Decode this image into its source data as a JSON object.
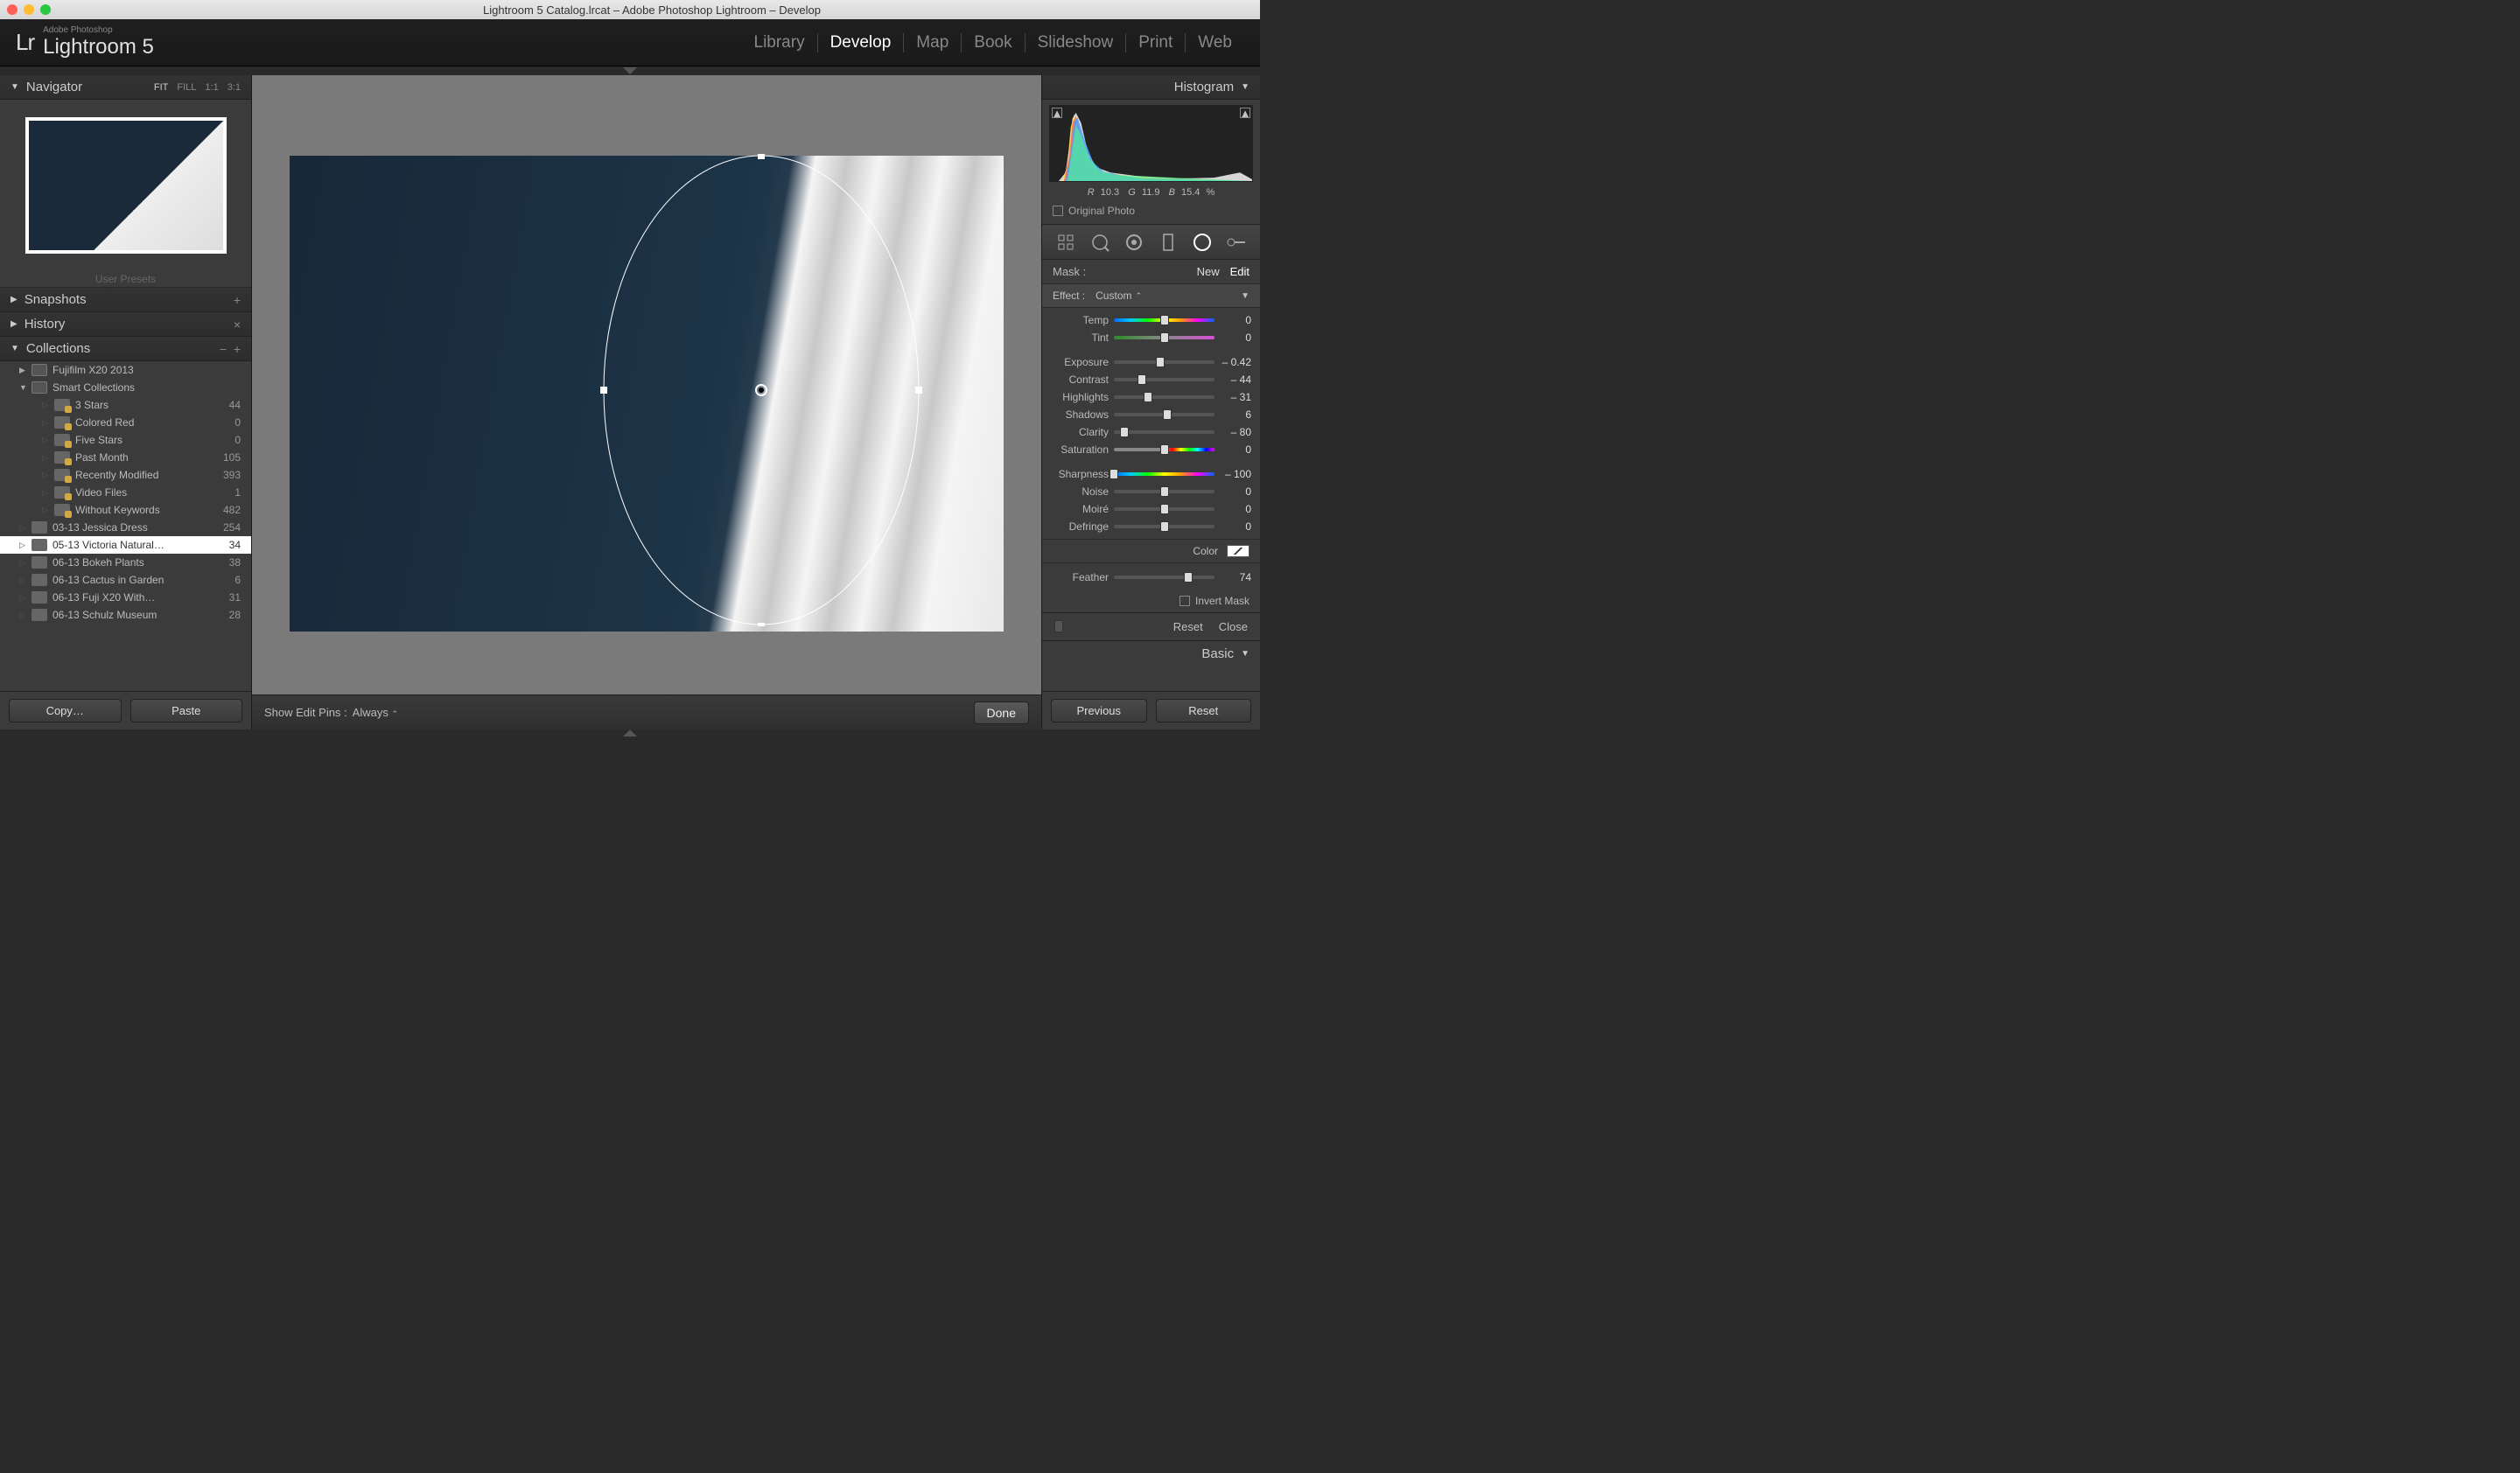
{
  "titlebar": {
    "title": "Lightroom 5 Catalog.lrcat – Adobe Photoshop Lightroom – Develop"
  },
  "logo": {
    "small": "Adobe Photoshop",
    "name": "Lightroom 5",
    "lr": "Lr"
  },
  "modules": [
    "Library",
    "Develop",
    "Map",
    "Book",
    "Slideshow",
    "Print",
    "Web"
  ],
  "active_module": "Develop",
  "left": {
    "navigator": {
      "title": "Navigator",
      "zoom": [
        "FIT",
        "FILL",
        "1:1",
        "3:1"
      ]
    },
    "user_presets": "User Presets",
    "snapshots": "Snapshots",
    "history": "History",
    "collections": "Collections",
    "tree": [
      {
        "label": "Fujifilm X20 2013",
        "count": "",
        "indent": 1,
        "arrow": "▶",
        "type": "set"
      },
      {
        "label": "Smart Collections",
        "count": "",
        "indent": 1,
        "arrow": "▼",
        "type": "set"
      },
      {
        "label": "3 Stars",
        "count": "44",
        "indent": 2,
        "type": "smart"
      },
      {
        "label": "Colored Red",
        "count": "0",
        "indent": 2,
        "type": "smart"
      },
      {
        "label": "Five Stars",
        "count": "0",
        "indent": 2,
        "type": "smart"
      },
      {
        "label": "Past Month",
        "count": "105",
        "indent": 2,
        "type": "smart"
      },
      {
        "label": "Recently Modified",
        "count": "393",
        "indent": 2,
        "type": "smart"
      },
      {
        "label": "Video Files",
        "count": "1",
        "indent": 2,
        "type": "smart"
      },
      {
        "label": "Without Keywords",
        "count": "482",
        "indent": 2,
        "type": "smart"
      },
      {
        "label": "03-13 Jessica Dress",
        "count": "254",
        "indent": 1,
        "type": "coll"
      },
      {
        "label": "05-13 Victoria Natural…",
        "count": "34",
        "indent": 1,
        "type": "coll",
        "selected": true
      },
      {
        "label": "06-13 Bokeh Plants",
        "count": "38",
        "indent": 1,
        "type": "coll"
      },
      {
        "label": "06-13 Cactus in Garden",
        "count": "6",
        "indent": 1,
        "type": "coll"
      },
      {
        "label": "06-13 Fuji X20 With…",
        "count": "31",
        "indent": 1,
        "type": "coll"
      },
      {
        "label": "06-13 Schulz Museum",
        "count": "28",
        "indent": 1,
        "type": "coll"
      }
    ],
    "copy": "Copy…",
    "paste": "Paste"
  },
  "center": {
    "edit_pins_label": "Show Edit Pins :",
    "edit_pins_value": "Always",
    "done": "Done"
  },
  "right": {
    "histogram": "Histogram",
    "rgb": {
      "r": "10.3",
      "g": "11.9",
      "b": "15.4",
      "pct": "%"
    },
    "original": "Original Photo",
    "mask_label": "Mask :",
    "mask_new": "New",
    "mask_edit": "Edit",
    "effect_label": "Effect :",
    "effect_value": "Custom",
    "sliders": {
      "temp": {
        "label": "Temp",
        "val": "0",
        "pos": 50,
        "track": "rainbow"
      },
      "tint": {
        "label": "Tint",
        "val": "0",
        "pos": 50,
        "track": "tint"
      },
      "exposure": {
        "label": "Exposure",
        "val": "– 0.42",
        "pos": 46
      },
      "contrast": {
        "label": "Contrast",
        "val": "– 44",
        "pos": 28
      },
      "highlights": {
        "label": "Highlights",
        "val": "– 31",
        "pos": 34
      },
      "shadows": {
        "label": "Shadows",
        "val": "6",
        "pos": 53
      },
      "clarity": {
        "label": "Clarity",
        "val": "– 80",
        "pos": 10
      },
      "saturation": {
        "label": "Saturation",
        "val": "0",
        "pos": 50,
        "track": "sat"
      },
      "sharpness": {
        "label": "Sharpness",
        "val": "– 100",
        "pos": 0,
        "track": "rainbow"
      },
      "noise": {
        "label": "Noise",
        "val": "0",
        "pos": 50
      },
      "moire": {
        "label": "Moiré",
        "val": "0",
        "pos": 50
      },
      "defringe": {
        "label": "Defringe",
        "val": "0",
        "pos": 50
      },
      "feather": {
        "label": "Feather",
        "val": "74",
        "pos": 74
      }
    },
    "color_label": "Color",
    "invert": "Invert Mask",
    "reset": "Reset",
    "close": "Close",
    "basic": "Basic",
    "previous": "Previous",
    "reset2": "Reset"
  }
}
